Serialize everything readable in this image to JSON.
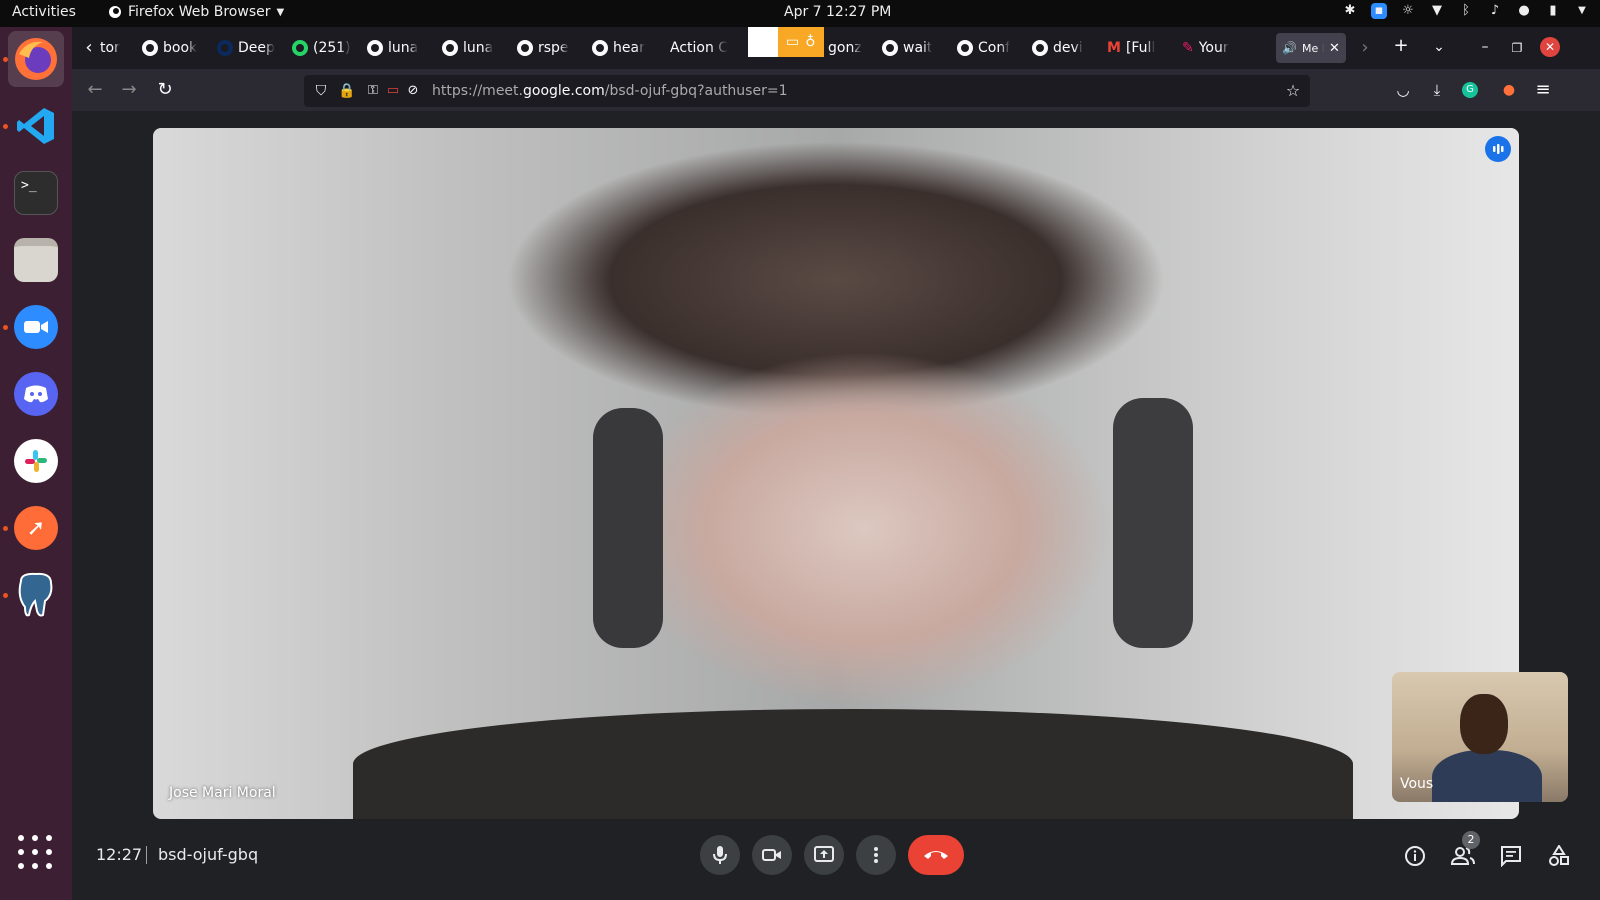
{
  "topbar": {
    "activities": "Activities",
    "app_name": "Firefox Web Browser",
    "clock": "Apr 7  12:27 PM"
  },
  "dock": {
    "items": [
      "firefox",
      "vscode",
      "terminal",
      "files",
      "zoom",
      "discord",
      "slack",
      "postman",
      "pgadmin"
    ],
    "apps_grid": "show-applications"
  },
  "browser": {
    "tabs": [
      {
        "label": "tor"
      },
      {
        "label": "book"
      },
      {
        "label": "Deep"
      },
      {
        "label": "(251)"
      },
      {
        "label": "luna"
      },
      {
        "label": "luna"
      },
      {
        "label": "rspe"
      },
      {
        "label": "hear"
      },
      {
        "label": "Action C"
      },
      {
        "label": "gonz"
      },
      {
        "label": "wait"
      },
      {
        "label": "Conf"
      },
      {
        "label": "devi"
      },
      {
        "label": "[Full"
      },
      {
        "label": "Your"
      },
      {
        "label": "Me PL"
      }
    ],
    "url_prefix": "https://meet.",
    "url_domain": "google.com",
    "url_path": "/bsd-ojuf-gbq?authuser=1"
  },
  "meet": {
    "main_participant": "Jose Mari Moral",
    "self_label": "Vous",
    "time": "12:27",
    "meeting_code": "bsd-ojuf-gbq",
    "participants_count": "2"
  },
  "colors": {
    "accent": "#1a73e8",
    "end_call": "#ea4335",
    "dock_bg": "#3c1f32"
  }
}
